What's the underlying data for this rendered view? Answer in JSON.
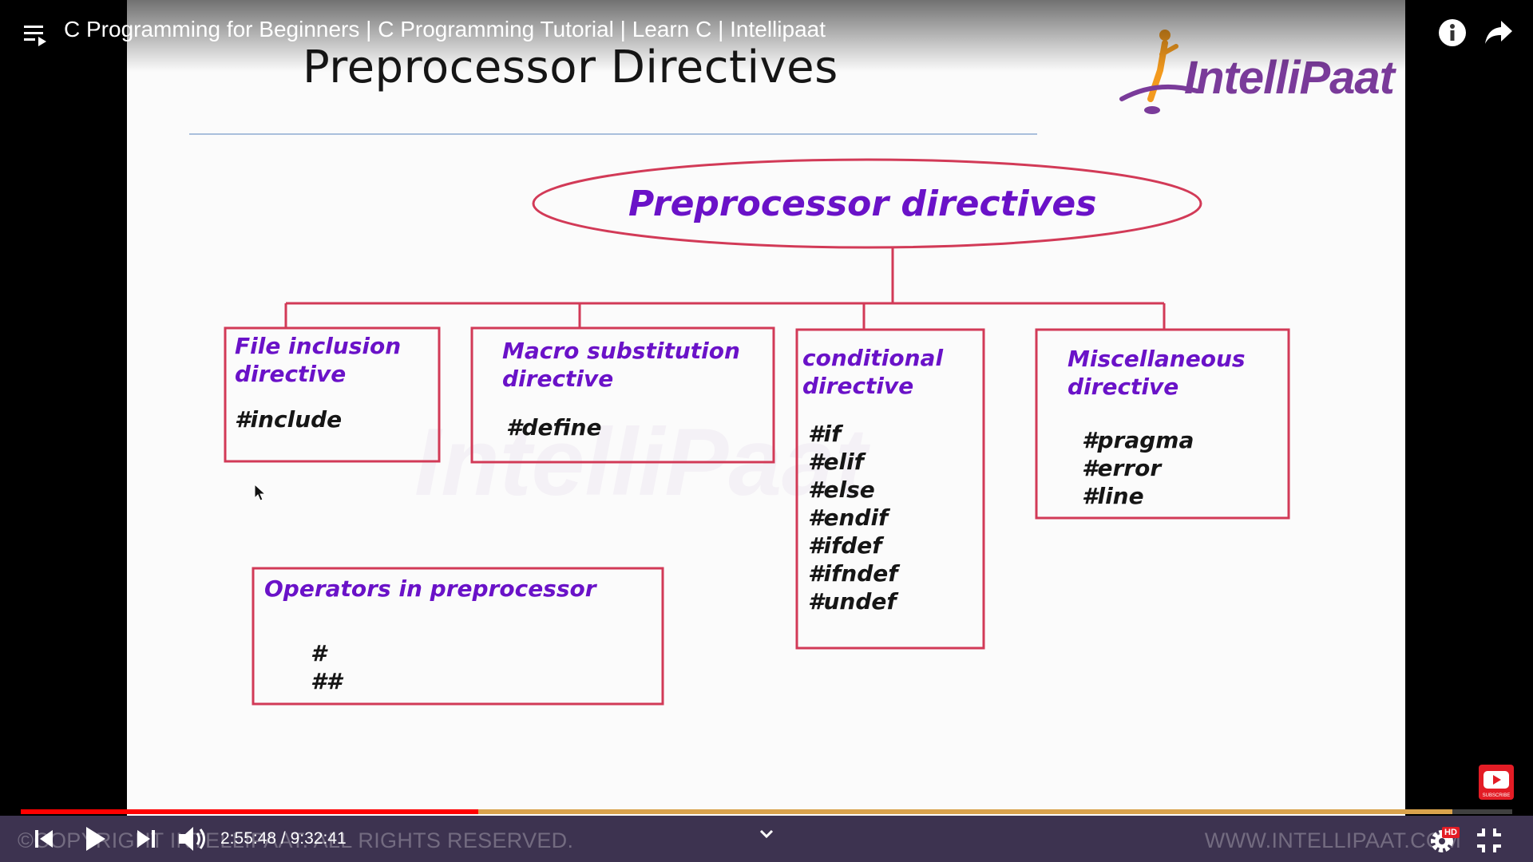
{
  "video": {
    "title": "C Programming for Beginners | C Programming Tutorial | Learn C | Intellipaat",
    "time_current": "2:55:48",
    "time_total": "9:32:41",
    "progress_played": 0.307,
    "progress_buffered": 0.96
  },
  "slide": {
    "title": "Preprocessor Directives",
    "logo": "IntelliPaat",
    "root": "Preprocessor directives",
    "boxes": {
      "file_inclusion": {
        "heading": [
          "File inclusion",
          "directive"
        ],
        "items": [
          "#include"
        ]
      },
      "macro": {
        "heading": [
          "Macro substitution",
          "directive"
        ],
        "items": [
          "#define"
        ]
      },
      "conditional": {
        "heading": [
          "conditional",
          "directive"
        ],
        "items": [
          "#if",
          "#elif",
          "#else",
          "#endif",
          "#ifdef",
          "#ifndef",
          "#undef"
        ]
      },
      "misc": {
        "heading": [
          "Miscellaneous",
          "directive"
        ],
        "items": [
          "#pragma",
          "#error",
          "#line"
        ]
      },
      "operators": {
        "heading": [
          "Operators in preprocessor"
        ],
        "items": [
          "#",
          "##"
        ]
      }
    },
    "colors": {
      "box_border": "#d23a57",
      "heading_text": "#6a12c8"
    }
  },
  "overlay": {
    "bottom_left": "©COPYRIGHT INTELLIPAAT. ALL RIGHTS RESERVED.",
    "bottom_right": "WWW.INTELLIPAAT.COM",
    "subscribe_label": "SUBSCRIBE",
    "hd_badge": "HD"
  },
  "icons": [
    "playlist-icon",
    "info-icon",
    "share-icon",
    "previous-icon",
    "play-icon",
    "next-icon",
    "volume-icon",
    "chevron-down-icon",
    "settings-icon",
    "exit-fullscreen-icon",
    "subscribe-icon"
  ]
}
